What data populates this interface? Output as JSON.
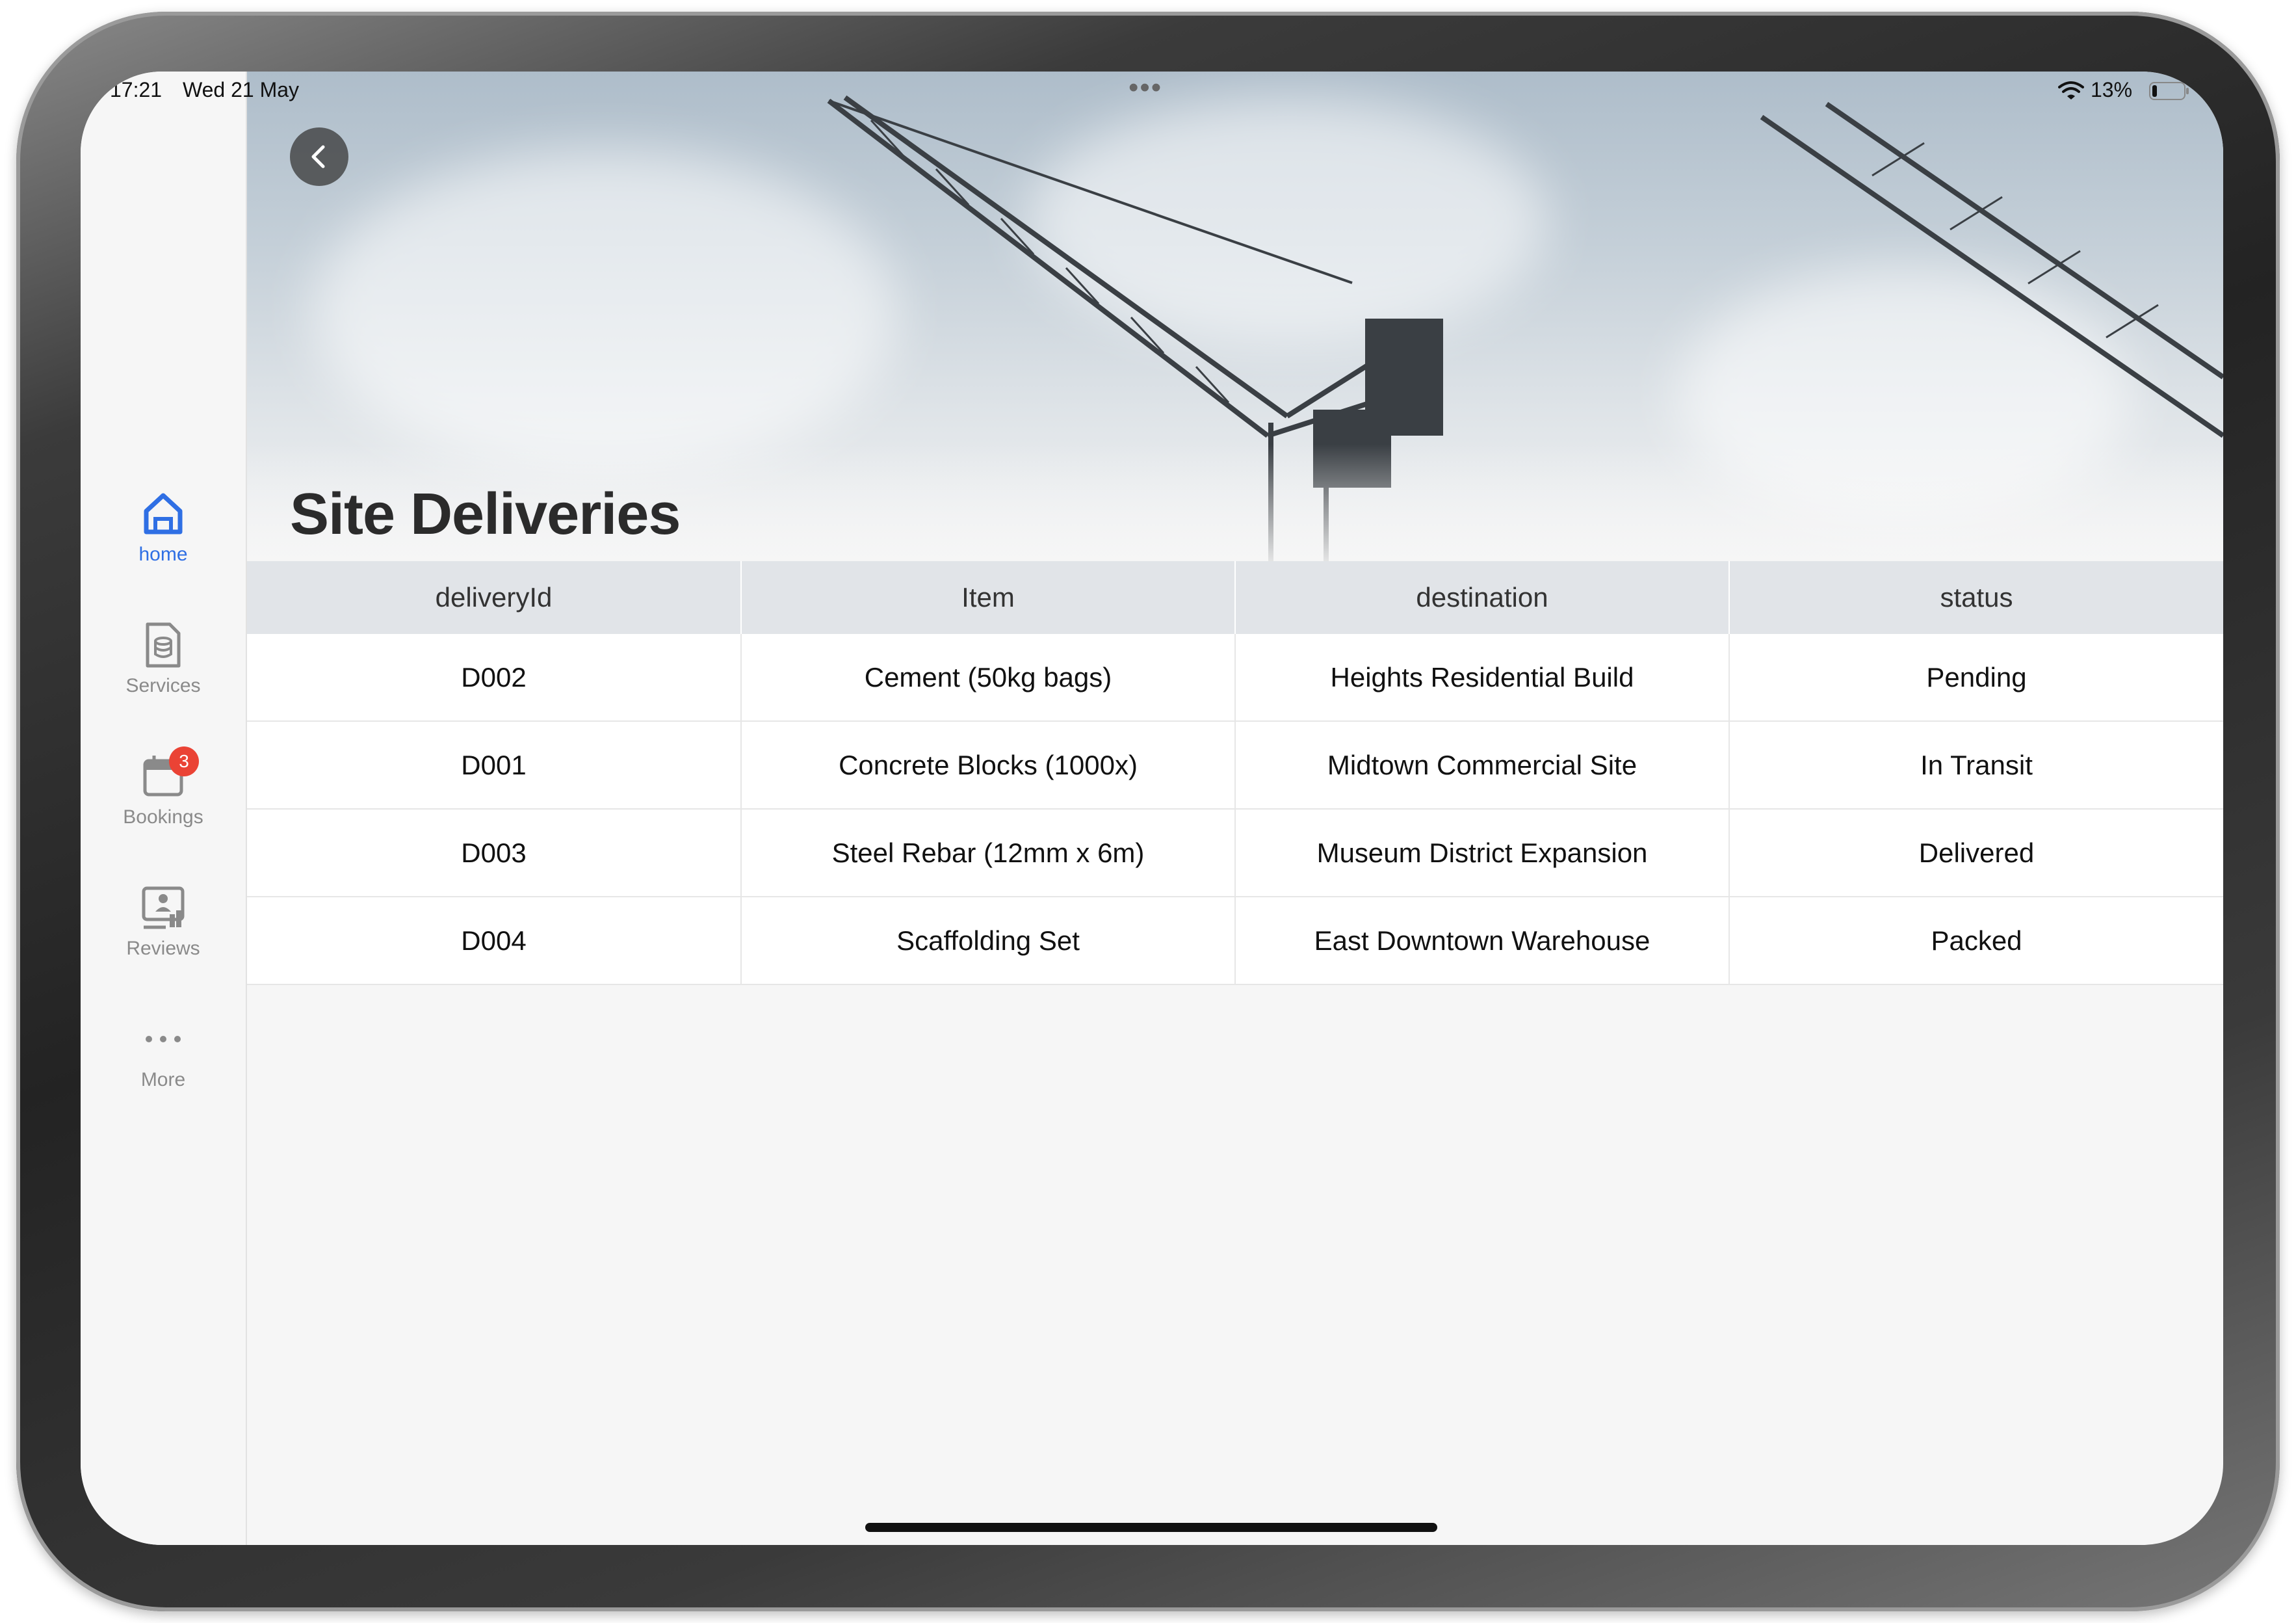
{
  "status_bar": {
    "time": "17:21",
    "date": "Wed 21 May",
    "dots": "•••",
    "battery": "13%"
  },
  "sidebar": {
    "accent_color": "#2f6fe4",
    "items": [
      {
        "label": "home",
        "icon": "home-icon",
        "active": true
      },
      {
        "label": "Services",
        "icon": "document-icon",
        "active": false
      },
      {
        "label": "Bookings",
        "icon": "calendar-icon",
        "active": false,
        "badge": "3"
      },
      {
        "label": "Reviews",
        "icon": "reviews-icon",
        "active": false
      },
      {
        "label": "More",
        "icon": "more-icon",
        "active": false
      }
    ]
  },
  "page": {
    "title": "Site Deliveries"
  },
  "table": {
    "columns": [
      "deliveryId",
      "Item",
      "destination",
      "status"
    ],
    "rows": [
      [
        "D002",
        "Cement (50kg bags)",
        "Heights Residential Build",
        "Pending"
      ],
      [
        "D001",
        "Concrete Blocks (1000x)",
        "Midtown Commercial Site",
        "In Transit"
      ],
      [
        "D003",
        "Steel Rebar (12mm x 6m)",
        "Museum District Expansion",
        "Delivered"
      ],
      [
        "D004",
        "Scaffolding Set",
        "East Downtown Warehouse",
        "Packed"
      ]
    ]
  }
}
